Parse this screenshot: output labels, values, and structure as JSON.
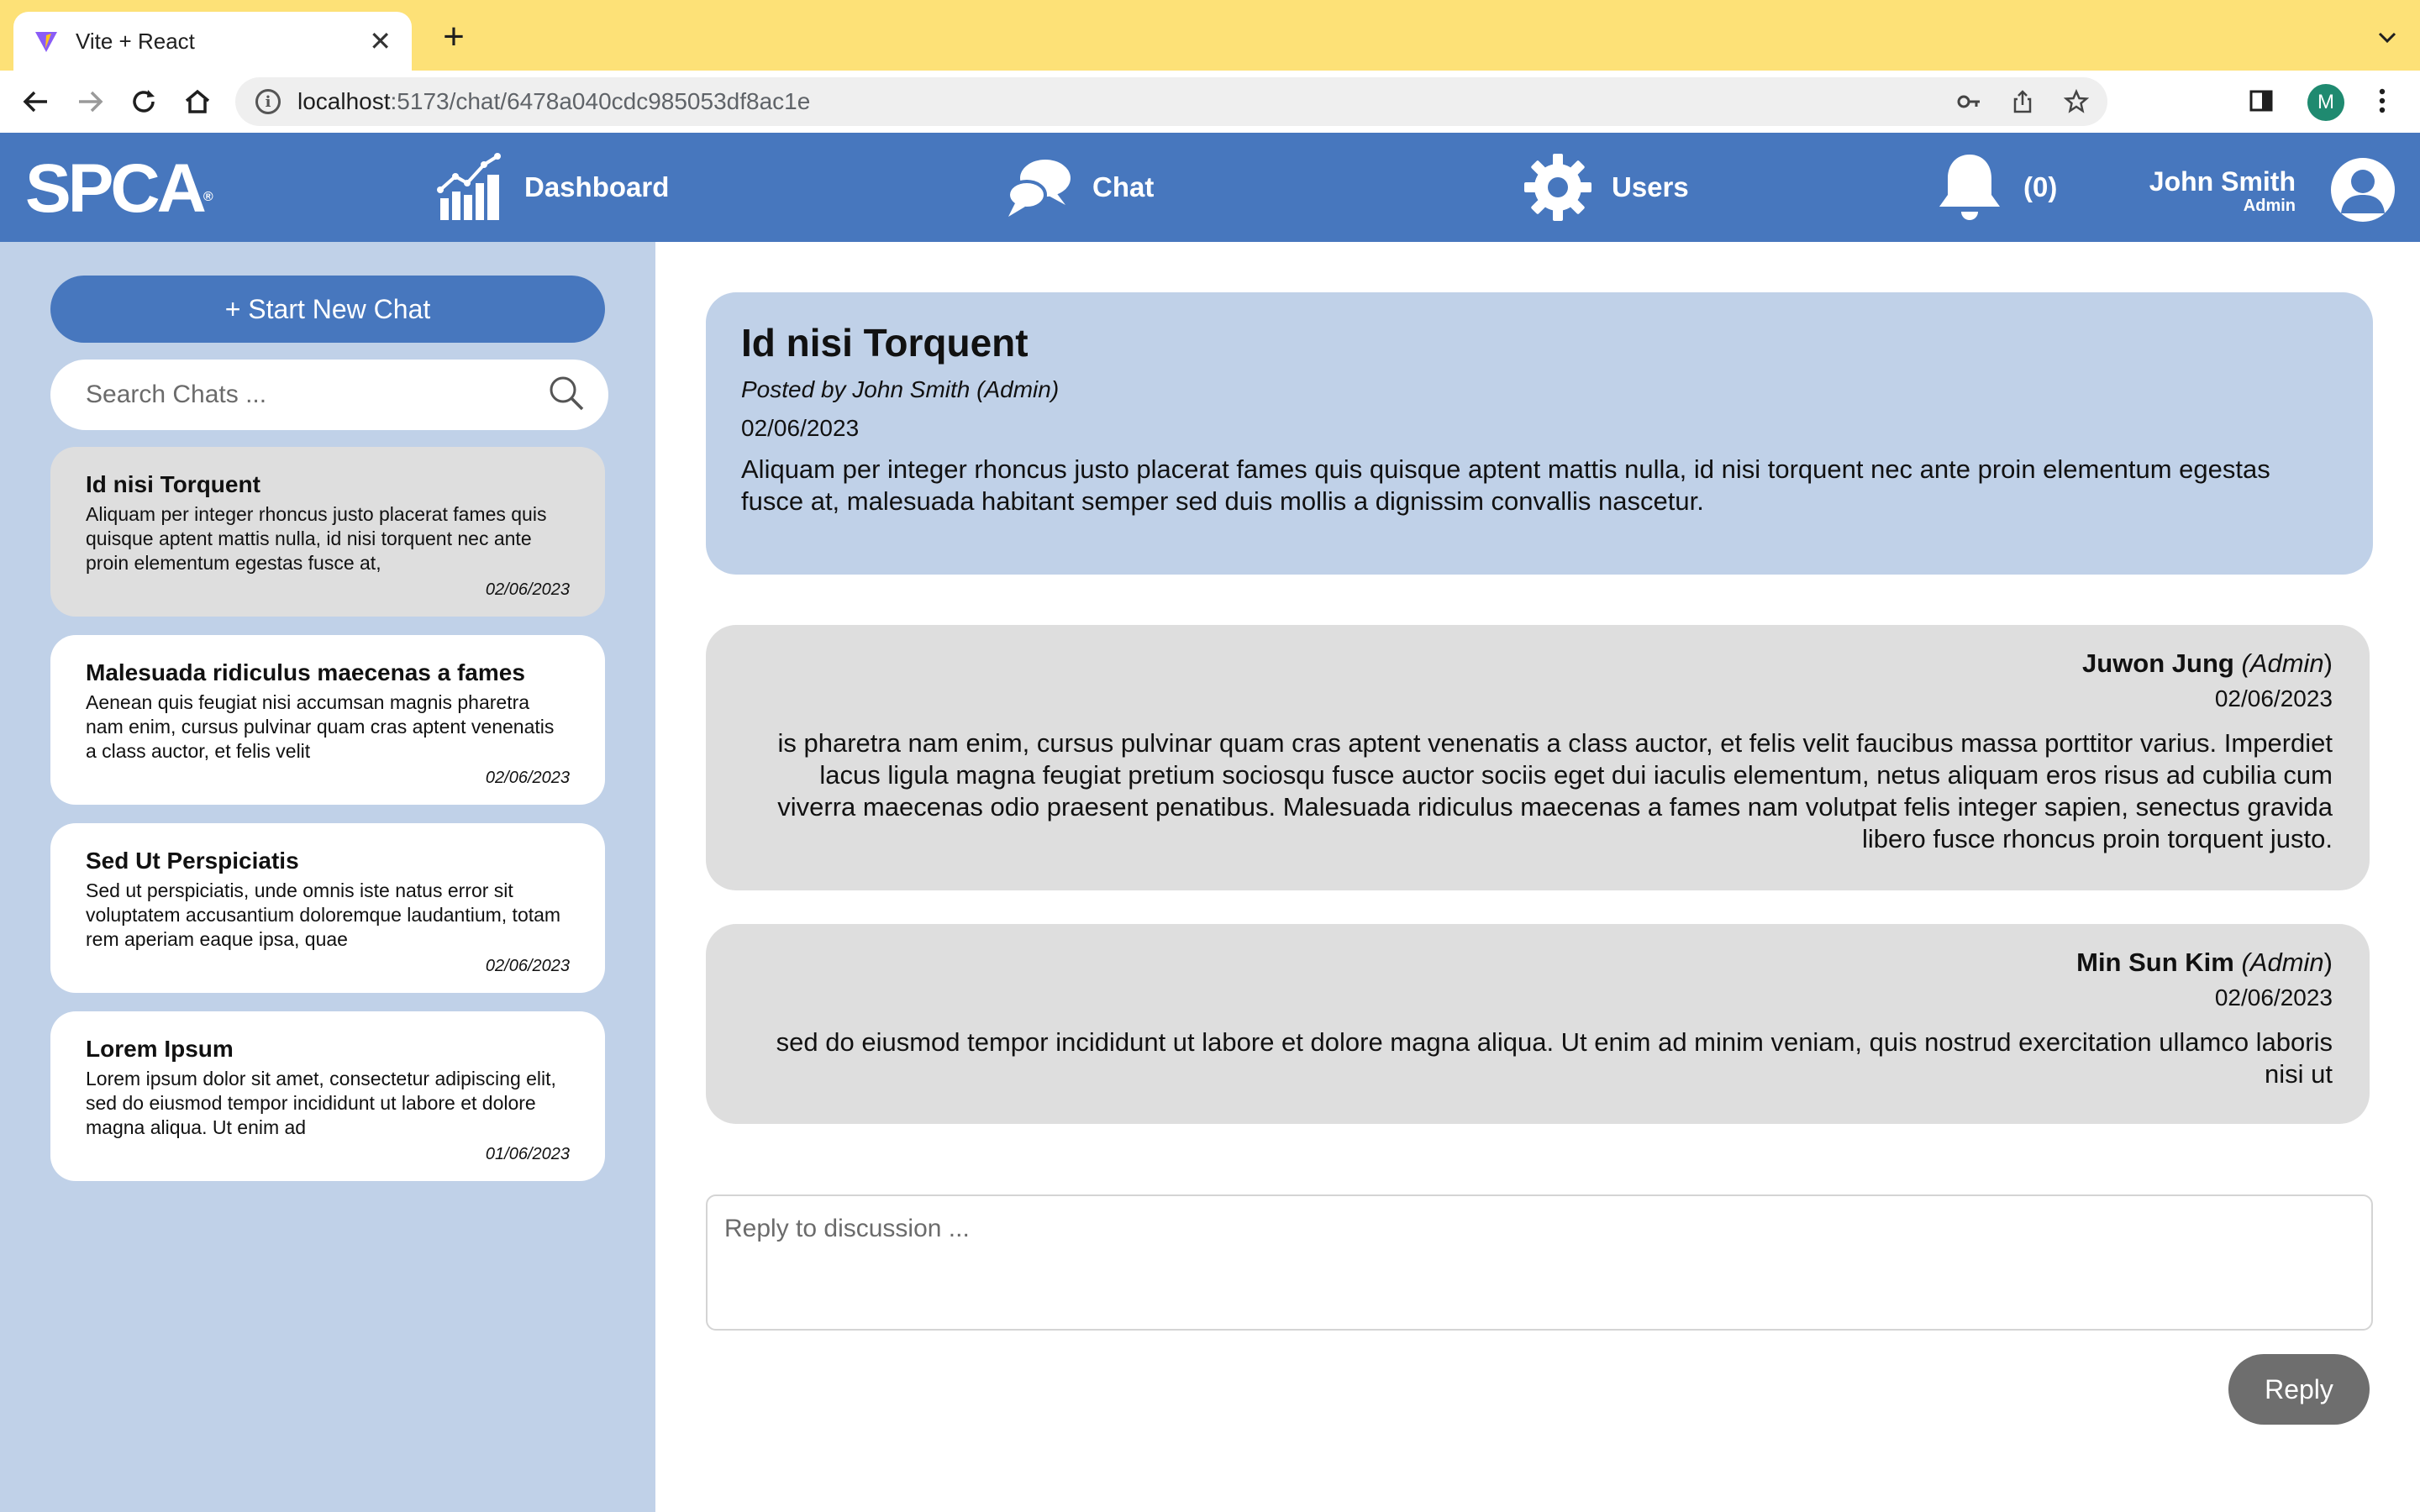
{
  "browser": {
    "tab_title": "Vite + React",
    "url_host": "localhost",
    "url_rest": ":5173/chat/6478a040cdc985053df8ac1e",
    "profile_initial": "M"
  },
  "header": {
    "logo_text": "SPCA",
    "logo_mark": "®",
    "nav": {
      "dashboard": "Dashboard",
      "chat": "Chat",
      "users": "Users",
      "notifications": "(0)"
    },
    "user": {
      "name": "John Smith",
      "role": "Admin"
    }
  },
  "sidebar": {
    "new_chat_label": "+ Start New Chat",
    "search_placeholder": "Search Chats ...",
    "chats": [
      {
        "title": "Id nisi Torquent",
        "preview": "Aliquam per integer rhoncus justo placerat fames quis quisque aptent mattis nulla, id nisi torquent nec ante proin elementum egestas fusce at,",
        "date": "02/06/2023"
      },
      {
        "title": "Malesuada ridiculus maecenas a fames",
        "preview": "Aenean quis feugiat nisi accumsan magnis pharetra nam enim, cursus pulvinar quam cras aptent venenatis a class auctor, et felis velit",
        "date": "02/06/2023"
      },
      {
        "title": "Sed Ut Perspiciatis",
        "preview": "Sed ut perspiciatis, unde omnis iste natus error sit voluptatem accusantium doloremque laudantium, totam rem aperiam eaque ipsa, quae",
        "date": "02/06/2023"
      },
      {
        "title": "Lorem Ipsum",
        "preview": "Lorem ipsum dolor sit amet, consectetur adipiscing elit, sed do eiusmod tempor incididunt ut labore et dolore magna aliqua. Ut enim ad",
        "date": "01/06/2023"
      }
    ]
  },
  "post": {
    "title": "Id nisi Torquent",
    "posted_by": "Posted by John Smith (Admin)",
    "date": "02/06/2023",
    "body": "Aliquam per integer rhoncus justo placerat fames quis quisque aptent mattis nulla, id nisi torquent nec ante proin elementum egestas fusce at, malesuada habitant semper sed duis mollis a dignissim convallis nascetur."
  },
  "replies": [
    {
      "author": "Juwon Jung",
      "role": "(Admin",
      "role_close": ")",
      "date": "02/06/2023",
      "text": "is pharetra nam enim, cursus pulvinar quam cras aptent venenatis a class auctor, et felis velit faucibus massa porttitor varius. Imperdiet lacus ligula magna feugiat pretium sociosqu fusce auctor sociis eget dui iaculis elementum, netus aliquam eros risus ad cubilia cum viverra maecenas odio praesent penatibus. Malesuada ridiculus maecenas a fames nam volutpat felis integer sapien, senectus gravida libero fusce rhoncus proin torquent justo."
    },
    {
      "author": "Min Sun Kim",
      "role": "(Admin",
      "role_close": ")",
      "date": "02/06/2023",
      "text": "sed do eiusmod tempor incididunt ut labore et dolore magna aliqua. Ut enim ad minim veniam, quis nostrud exercitation ullamco laboris nisi ut"
    }
  ],
  "reply_form": {
    "placeholder": "Reply to discussion ...",
    "button_label": "Reply"
  },
  "colors": {
    "header": "#4777be",
    "sidebar": "#c0d1e8",
    "tabstrip": "#fde177",
    "reply_card": "#dedede",
    "reply_button": "#6e6e6e"
  }
}
